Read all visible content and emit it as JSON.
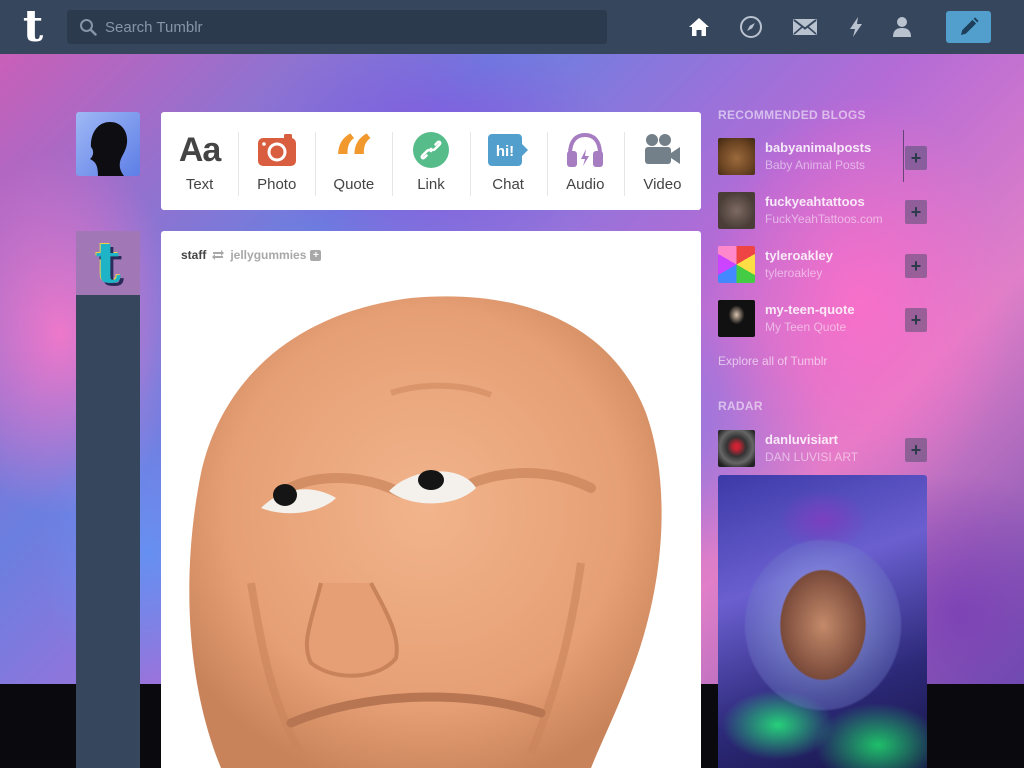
{
  "search": {
    "placeholder": "Search Tumblr"
  },
  "nav": {
    "icons": [
      "home-icon",
      "explore-compass-icon",
      "inbox-envelope-icon",
      "activity-lightning-icon",
      "account-person-icon",
      "compose-pencil-icon"
    ]
  },
  "post_types": [
    {
      "label": "Text",
      "icon": "text-aa-icon",
      "color": "#444444"
    },
    {
      "label": "Photo",
      "icon": "camera-icon",
      "color": "#d95e40"
    },
    {
      "label": "Quote",
      "icon": "quote-icon",
      "color": "#f2992e"
    },
    {
      "label": "Link",
      "icon": "link-icon",
      "color": "#56bc8a"
    },
    {
      "label": "Chat",
      "icon": "chat-bubble-icon",
      "color": "#529ecc"
    },
    {
      "label": "Audio",
      "icon": "headphones-icon",
      "color": "#a77dc2"
    },
    {
      "label": "Video",
      "icon": "video-camera-icon",
      "color": "#748089"
    }
  ],
  "post": {
    "author": "staff",
    "source": "jellygummies"
  },
  "sidebar": {
    "recommended_title": "RECOMMENDED BLOGS",
    "recommended": [
      {
        "name": "babyanimalposts",
        "title": "Baby Animal Posts"
      },
      {
        "name": "fuckyeahtattoos",
        "title": "FuckYeahTattoos.com"
      },
      {
        "name": "tyleroakley",
        "title": "tyleroakley"
      },
      {
        "name": "my-teen-quote",
        "title": "My Teen Quote"
      }
    ],
    "explore": "Explore all of Tumblr",
    "radar_title": "RADAR",
    "radar": {
      "name": "danluvisiart",
      "title": "DAN LUVISI ART"
    }
  },
  "colors": {
    "nav_bg": "#36465d",
    "compose": "#529ecc"
  }
}
